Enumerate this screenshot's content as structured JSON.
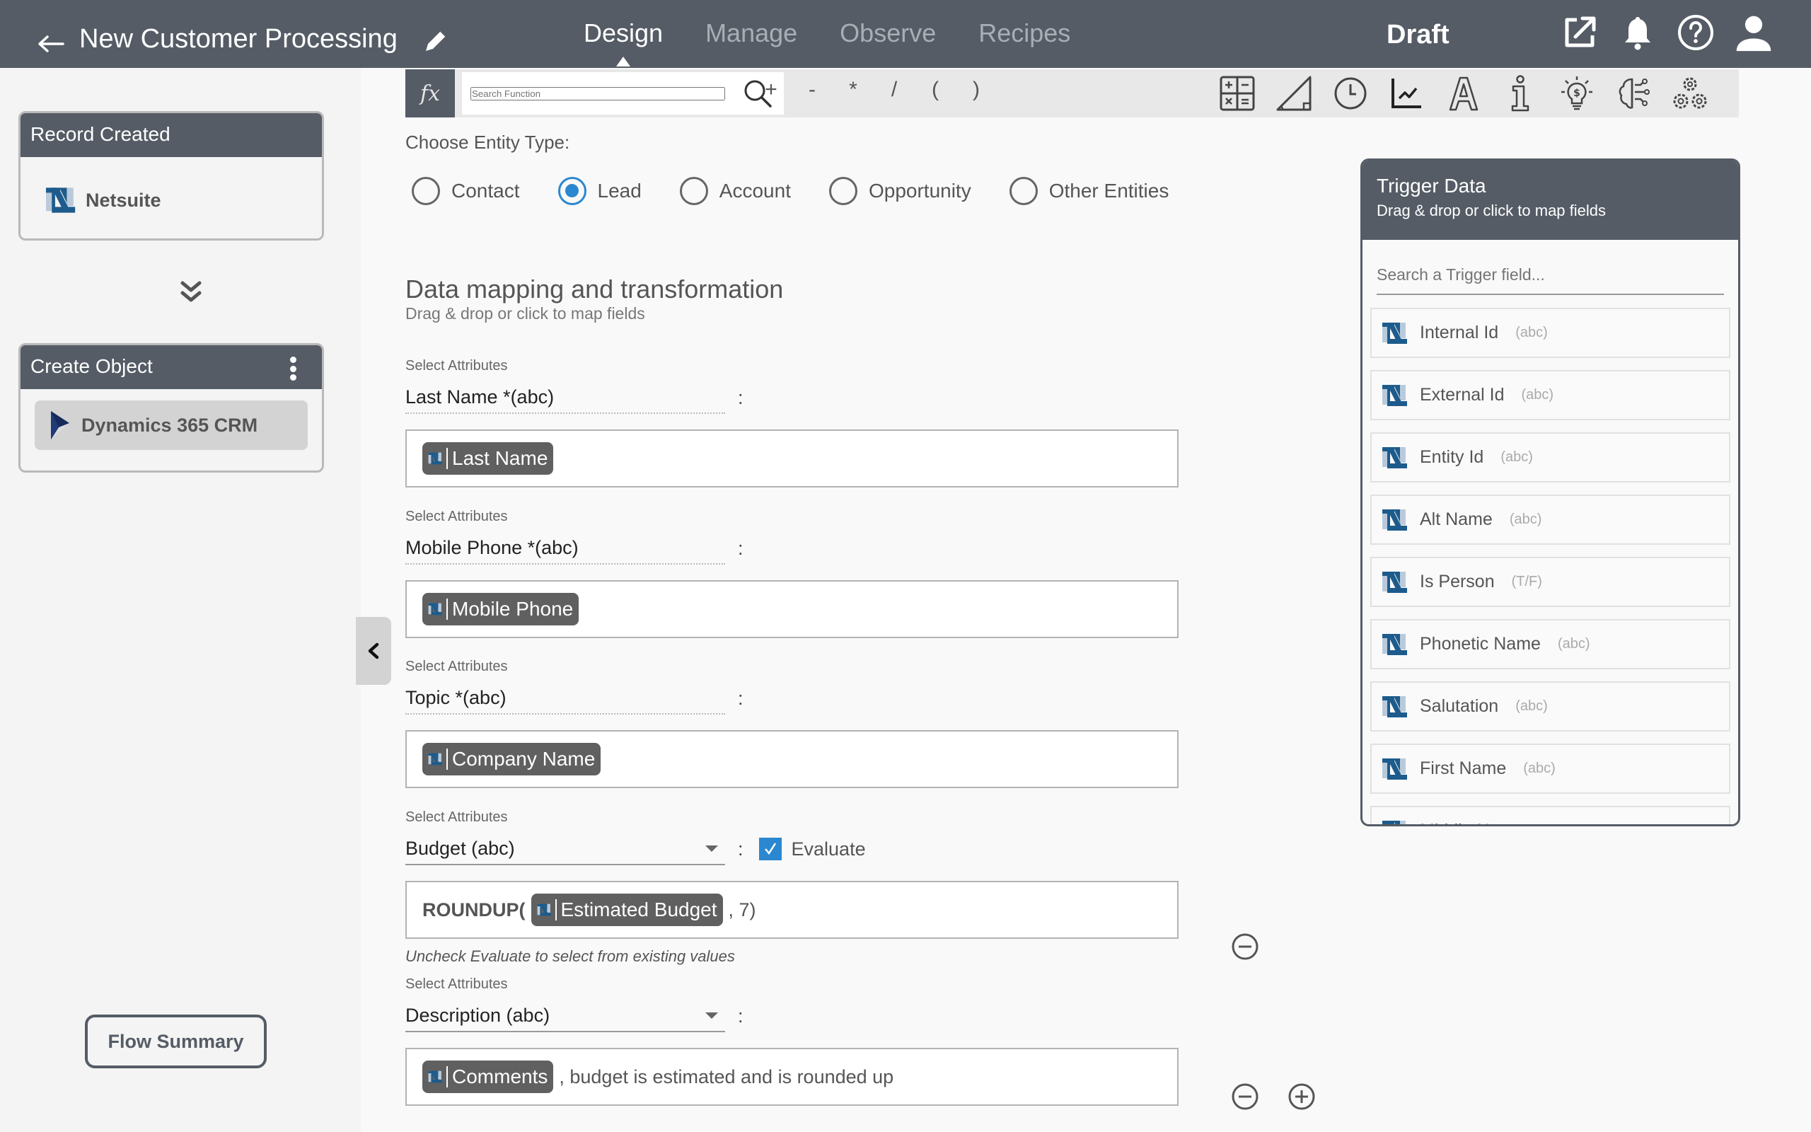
{
  "header": {
    "title": "New Customer Processing",
    "tabs": [
      {
        "label": "Design",
        "active": true
      },
      {
        "label": "Manage",
        "active": false
      },
      {
        "label": "Observe",
        "active": false
      },
      {
        "label": "Recipes",
        "active": false
      }
    ],
    "status": "Draft",
    "icons": [
      "external-link-icon",
      "bell-icon",
      "help-icon",
      "user-icon"
    ]
  },
  "sidebar": {
    "trigger_node": {
      "title": "Record Created",
      "app": "Netsuite"
    },
    "action_node": {
      "title": "Create Object",
      "app": "Dynamics 365 CRM"
    },
    "flow_summary_label": "Flow Summary"
  },
  "toolbar": {
    "fx_label": "fx",
    "search_placeholder": "Search Function",
    "operators": [
      "+",
      "-",
      "*",
      "/",
      "(",
      ")"
    ],
    "tool_icons": [
      "math-icon",
      "trigonometry-icon",
      "clock-icon",
      "line-chart-icon",
      "text-icon",
      "info-icon",
      "finance-bulb-icon",
      "ai-brain-icon",
      "gears-icon"
    ]
  },
  "entity": {
    "label": "Choose Entity Type:",
    "options": [
      {
        "label": "Contact",
        "checked": false
      },
      {
        "label": "Lead",
        "checked": true
      },
      {
        "label": "Account",
        "checked": false
      },
      {
        "label": "Opportunity",
        "checked": false
      },
      {
        "label": "Other Entities",
        "checked": false
      }
    ]
  },
  "mapping": {
    "title": "Data mapping and transformation",
    "subtitle": "Drag & drop or click to map fields",
    "select_label": "Select Attributes",
    "colon": ":",
    "rows": [
      {
        "attribute": "Last Name *(abc)",
        "chip": "Last Name",
        "prefix": "",
        "suffix": ""
      },
      {
        "attribute": "Mobile Phone *(abc)",
        "chip": "Mobile Phone",
        "prefix": "",
        "suffix": ""
      },
      {
        "attribute": "Topic *(abc)",
        "chip": "Company Name",
        "prefix": "",
        "suffix": ""
      },
      {
        "attribute": "Budget (abc)",
        "chip": "Estimated Budget",
        "prefix": "ROUNDUP(",
        "suffix": ", 7)",
        "evaluate_label": "Evaluate",
        "evaluate_checked": true,
        "hint": "Uncheck Evaluate to select from existing values"
      },
      {
        "attribute": "Description (abc)",
        "chip": "Comments",
        "prefix": "",
        "suffix": ", budget is estimated and is rounded up"
      }
    ]
  },
  "trigger_panel": {
    "title": "Trigger Data",
    "subtitle": "Drag & drop or click to map fields",
    "search_placeholder": "Search a Trigger field...",
    "fields": [
      {
        "name": "Internal Id",
        "type": "(abc)"
      },
      {
        "name": "External Id",
        "type": "(abc)"
      },
      {
        "name": "Entity Id",
        "type": "(abc)"
      },
      {
        "name": "Alt Name",
        "type": "(abc)"
      },
      {
        "name": "Is Person",
        "type": "(T/F)"
      },
      {
        "name": "Phonetic Name",
        "type": "(abc)"
      },
      {
        "name": "Salutation",
        "type": "(abc)"
      },
      {
        "name": "First Name",
        "type": "(abc)"
      },
      {
        "name": "Middle Name",
        "type": "(abc)"
      }
    ]
  },
  "colors": {
    "header_bg": "#555c66",
    "accent": "#2a87d0",
    "chip_bg": "#606060",
    "netsuite_blue": "#1d5b8c"
  }
}
